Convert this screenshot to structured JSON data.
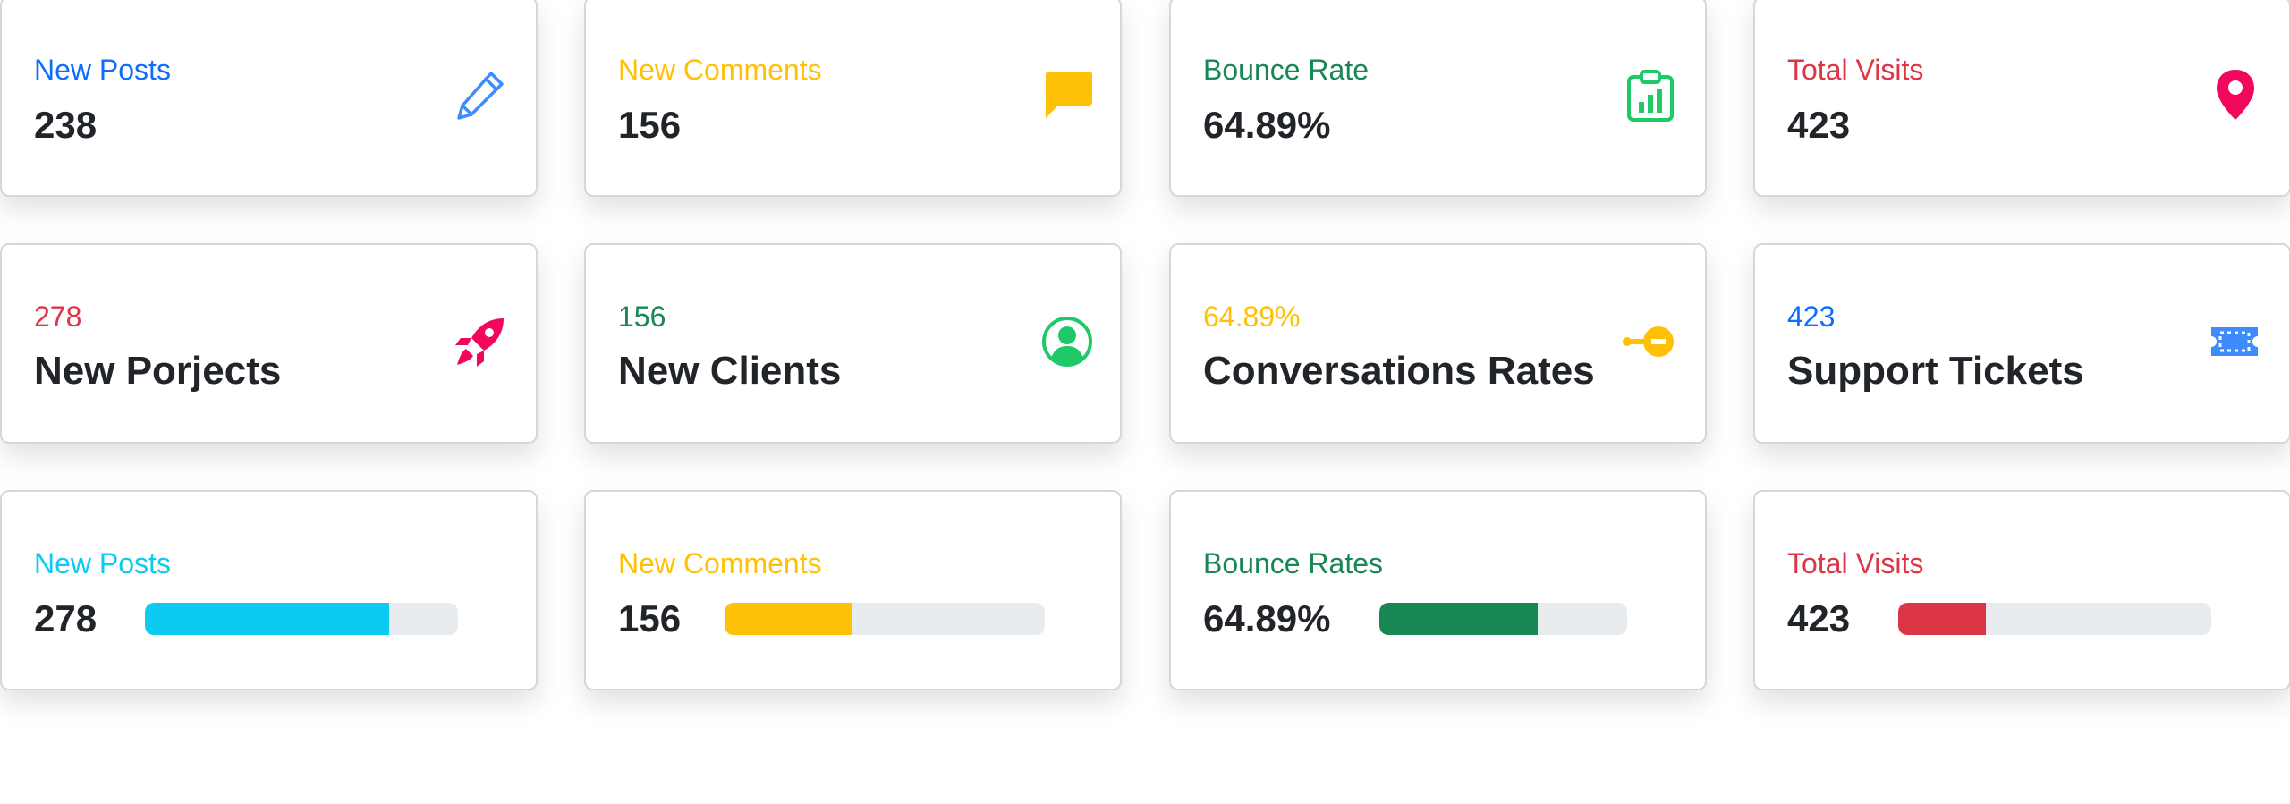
{
  "row1": [
    {
      "label": "New Posts",
      "value": "238",
      "icon": "pencil-icon",
      "color": "#0d6efd"
    },
    {
      "label": "New Comments",
      "value": "156",
      "icon": "chat-bubble-icon",
      "color": "#ffc107"
    },
    {
      "label": "Bounce Rate",
      "value": "64.89%",
      "icon": "clipboard-chart-icon",
      "color": "#198754"
    },
    {
      "label": "Total Visits",
      "value": "423",
      "icon": "map-pin-icon",
      "color": "#dc3545"
    }
  ],
  "row2": [
    {
      "number": "278",
      "title": "New Porjects",
      "icon": "rocket-icon",
      "color": "#dc3545"
    },
    {
      "number": "156",
      "title": "New Clients",
      "icon": "user-circle-icon",
      "color": "#198754"
    },
    {
      "number": "64.89%",
      "title": "Conversations Rates",
      "icon": "key-icon",
      "color": "#ffc107"
    },
    {
      "number": "423",
      "title": "Support Tickets",
      "icon": "ticket-icon",
      "color": "#0d6efd"
    }
  ],
  "row3": [
    {
      "label": "New Posts",
      "value": "278",
      "progress": 0.78,
      "color": "#0dcaf0"
    },
    {
      "label": "New Comments",
      "value": "156",
      "progress": 0.4,
      "color": "#ffc107"
    },
    {
      "label": "Bounce Rates",
      "value": "64.89%",
      "progress": 0.64,
      "color": "#198754"
    },
    {
      "label": "Total Visits",
      "value": "423",
      "progress": 0.28,
      "color": "#dc3545"
    }
  ],
  "icon_colors": {
    "pencil": "#3d8bfd",
    "chat": "#ffc107",
    "clipboard": "#20c967",
    "pin": "#f1085c",
    "rocket": "#f1085c",
    "user": "#20c967",
    "key": "#ffc107",
    "ticket": "#3d8bfd"
  }
}
